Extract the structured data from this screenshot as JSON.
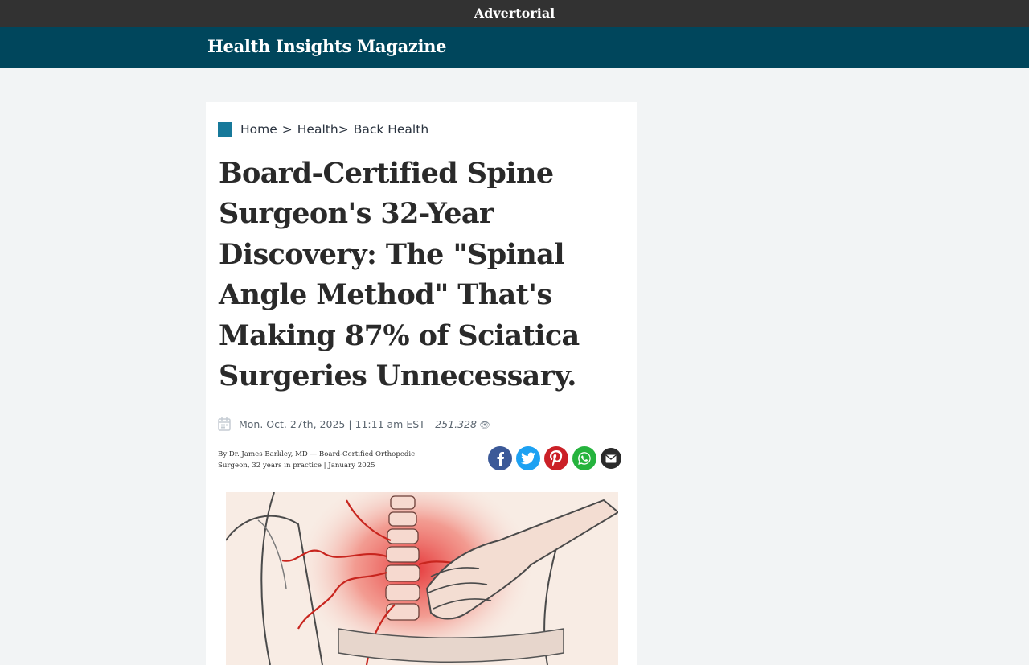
{
  "topbar": {
    "label": "Advertorial"
  },
  "brand": {
    "name": "Health Insights Magazine"
  },
  "breadcrumb": {
    "home": "Home",
    "sep": ">",
    "health": "Health",
    "sep2": ">",
    "back_health": "Back Health"
  },
  "article": {
    "headline": "Board-Certified Spine Surgeon's 32-Year Discovery: The \"Spinal Angle Method\" That's Making 87% of Sciatica Surgeries Unnecessary.",
    "date": "Mon. Oct. 27th, 2025 | 11:11 am EST -",
    "views": "251.328",
    "byline": "By Dr. James Barkley, MD — Board-Certified Orthopedic Surgeon, 32 years in practice | January 2025"
  },
  "share": {
    "icons": [
      "facebook-icon",
      "twitter-icon",
      "pinterest-icon",
      "whatsapp-icon",
      "email-icon"
    ]
  },
  "colors": {
    "topbar_bg": "#323232",
    "brandbar_bg": "#00465c",
    "accent": "#17799a",
    "page_bg": "#f2f4f5"
  }
}
